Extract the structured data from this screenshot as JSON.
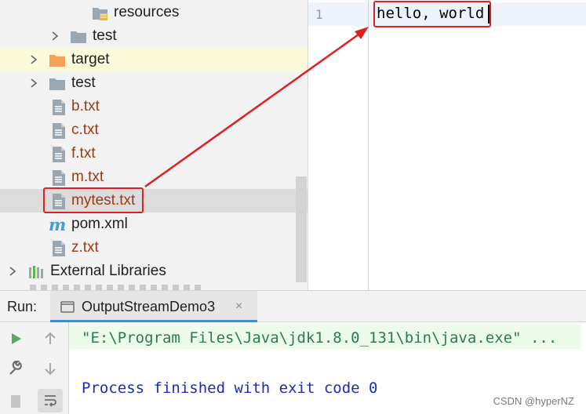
{
  "project_tree": {
    "items": [
      {
        "label": "resources",
        "type": "resources-folder",
        "color": "dark"
      },
      {
        "label": "test",
        "type": "folder",
        "color": "dark"
      },
      {
        "label": "target",
        "type": "orange-folder",
        "color": "dark"
      },
      {
        "label": "test",
        "type": "folder",
        "color": "dark"
      },
      {
        "label": "b.txt",
        "type": "text-file",
        "color": "red"
      },
      {
        "label": "c.txt",
        "type": "text-file",
        "color": "red"
      },
      {
        "label": "f.txt",
        "type": "text-file",
        "color": "red"
      },
      {
        "label": "m.txt",
        "type": "text-file",
        "color": "red"
      },
      {
        "label": "mytest.txt",
        "type": "text-file",
        "color": "red"
      },
      {
        "label": "pom.xml",
        "type": "maven-file",
        "color": "dark"
      },
      {
        "label": "z.txt",
        "type": "text-file",
        "color": "red"
      },
      {
        "label": "External Libraries",
        "type": "libraries",
        "color": "dark"
      }
    ]
  },
  "editor": {
    "line_number": "1",
    "code": "hello, world"
  },
  "run_panel": {
    "title": "Run:",
    "tab_label": "OutputStreamDemo3",
    "tab_close": "×",
    "command_line": "\"E:\\Program Files\\Java\\jdk1.8.0_131\\bin\\java.exe\" ...",
    "process_line": "Process finished with exit code 0"
  },
  "watermark": "CSDN @hyperNZ",
  "colors": {
    "annotation": "#e02020",
    "file_red": "#9c3b12",
    "console_green": "#2a7a5a",
    "console_blue": "#1e2ab8",
    "tab_underline": "#4a88c7"
  }
}
